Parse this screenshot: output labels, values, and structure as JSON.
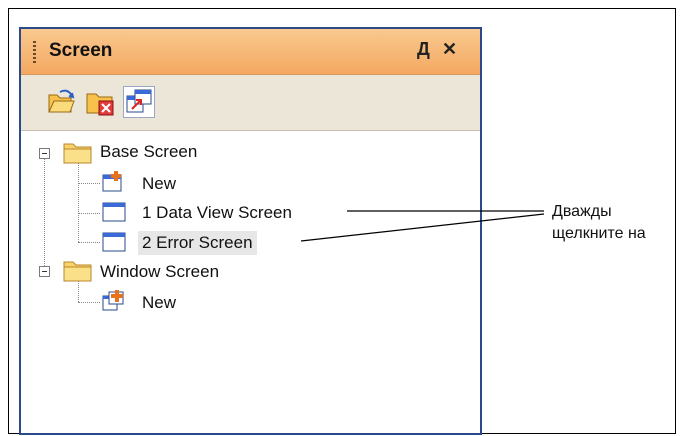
{
  "panel": {
    "title": "Screen",
    "pin_glyph": "Д",
    "close_glyph": "✕"
  },
  "toolbar": {
    "buttons": [
      {
        "icon": "open-folder-icon"
      },
      {
        "icon": "delete-folder-icon"
      },
      {
        "icon": "screen-properties-icon",
        "active": true
      }
    ]
  },
  "tree": {
    "base_screen": {
      "label": "Base Screen",
      "children": [
        "New",
        "1 Data View Screen",
        "2 Error Screen"
      ]
    },
    "window_screen": {
      "label": "Window Screen",
      "children": [
        "New"
      ]
    }
  },
  "annotation": {
    "line1": "Дважды",
    "line2": "щелкните на"
  },
  "colors": {
    "title_bar": "#f4a861",
    "border": "#2a4a8c",
    "folder": "#f7d36b",
    "new_plus": "#e8721c"
  }
}
